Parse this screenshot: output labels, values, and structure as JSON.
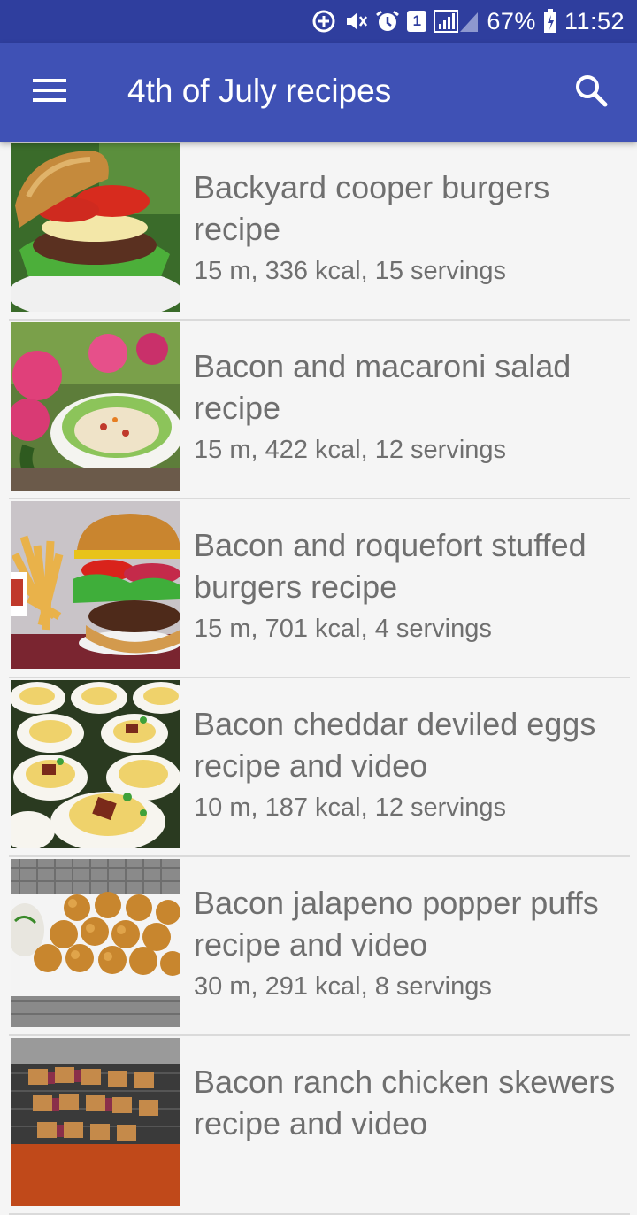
{
  "status_bar": {
    "badge": "1",
    "battery": "67%",
    "time": "11:52",
    "icons": [
      "data-saver-icon",
      "mute-icon",
      "alarm-icon",
      "sim-badge-icon",
      "signal-icon",
      "battery-icon"
    ]
  },
  "app_bar": {
    "title": "4th of July recipes",
    "menu_icon": "menu-icon",
    "search_icon": "search-icon"
  },
  "recipes": [
    {
      "title": "Backyard cooper burgers recipe",
      "meta": "15 m, 336 kcal, 15 servings",
      "image": "burger"
    },
    {
      "title": "Bacon and macaroni salad recipe",
      "meta": "15 m, 422 kcal, 12 servings",
      "image": "salad"
    },
    {
      "title": "Bacon and roquefort stuffed burgers recipe",
      "meta": "15 m, 701 kcal, 4 servings",
      "image": "burger-fries"
    },
    {
      "title": "Bacon cheddar deviled eggs recipe and video",
      "meta": "10 m, 187 kcal, 12 servings",
      "image": "deviled-eggs"
    },
    {
      "title": "Bacon jalapeno popper puffs recipe and video",
      "meta": "30 m, 291 kcal, 8 servings",
      "image": "popper-puffs"
    },
    {
      "title": "Bacon ranch chicken skewers recipe and video",
      "meta": "",
      "image": "skewers"
    }
  ],
  "colors": {
    "status_bar": "#2f3e9e",
    "app_bar": "#3f51b5",
    "text": "#6f6f6f",
    "background": "#f5f5f5"
  }
}
